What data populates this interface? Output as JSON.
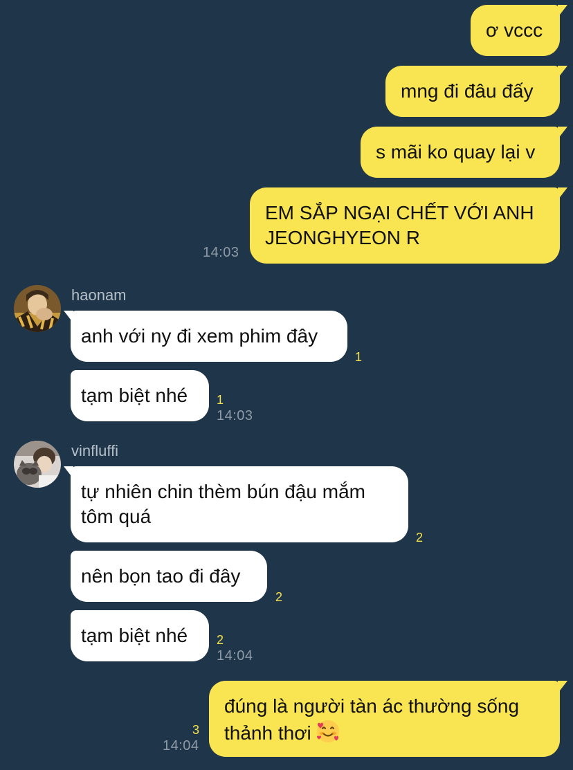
{
  "messages": {
    "m1": "ơ vccc",
    "m2": "mng đi đâu đấy",
    "m3": "s mãi ko quay lại v",
    "m4_line1": "EM SẮP NGẠI CHẾT VỚI ANH",
    "m4_line2": "JEONGHYEON R",
    "m4_time": "14:03",
    "haonam": {
      "name": "haonam",
      "msg1": "anh với ny đi xem phim đây",
      "msg1_unread": "1",
      "msg2": "tạm biệt nhé",
      "msg2_unread": "1",
      "msg2_time": "14:03"
    },
    "vinfluffi": {
      "name": "vinfluffi",
      "msg1_line1": "tự nhiên chin thèm bún đậu mắm",
      "msg1_line2": "tôm quá",
      "msg1_unread": "2",
      "msg2": "nên bọn tao đi đây",
      "msg2_unread": "2",
      "msg3": "tạm biệt nhé",
      "msg3_unread": "2",
      "msg3_time": "14:04"
    },
    "last_line1": "đúng là người tàn ác thường sống",
    "last_line2": "thảnh thơi",
    "last_emoji": "smiling-face-with-hearts-icon",
    "last_unread": "3",
    "last_time": "14:04"
  },
  "colors": {
    "background": "#1f3549",
    "outgoing_bubble": "#f9e451",
    "incoming_bubble": "#ffffff",
    "unread_count": "#f6e24a",
    "timestamp": "#8e9aa6"
  }
}
